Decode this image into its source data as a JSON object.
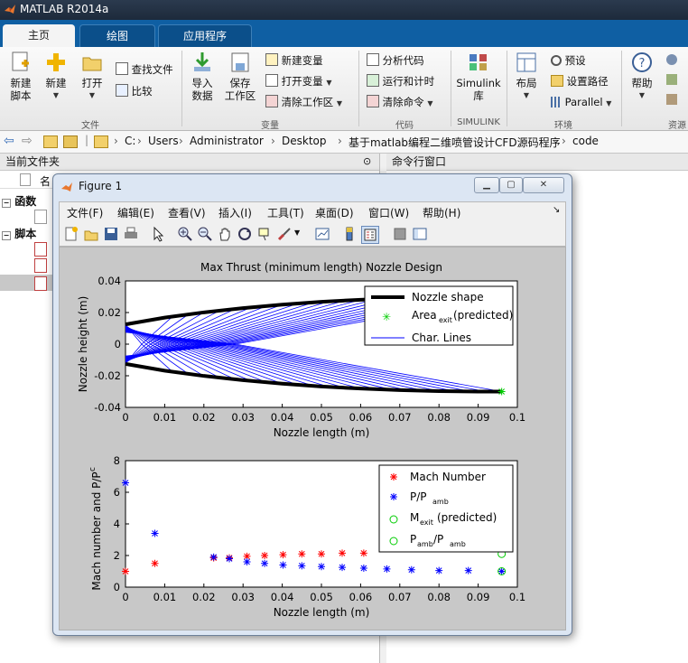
{
  "app": {
    "title": "MATLAB R2014a"
  },
  "tabs": [
    {
      "label": "主页",
      "active": true
    },
    {
      "label": "绘图",
      "active": false
    },
    {
      "label": "应用程序",
      "active": false
    }
  ],
  "ribbon": {
    "new_script": "新建\n脚本",
    "new": "新建",
    "open": "打开",
    "find_files": "查找文件",
    "compare": "比较",
    "file_group": "文件",
    "import_data": "导入\n数据",
    "save_workspace": "保存\n工作区",
    "new_variable": "新建变量",
    "open_variable": "打开变量",
    "clear_workspace": "清除工作区",
    "variable_group": "变量",
    "analyze_code": "分析代码",
    "run_and_time": "运行和计时",
    "clear_commands": "清除命令",
    "code_group": "代码",
    "simulink_lib": "Simulink\n库",
    "simulink_group": "SIMULINK",
    "layout": "布局",
    "preferences": "预设",
    "set_path": "设置路径",
    "parallel": "Parallel",
    "environment_group": "环境",
    "help": "帮助",
    "resources_group": "资源"
  },
  "address": {
    "crumbs": [
      "C:",
      "Users",
      "Administrator",
      "Desktop",
      "基于matlab编程二维喷管设计CFD源码程序",
      "code"
    ]
  },
  "panels": {
    "current_folder": "当前文件夹",
    "command_window": "命令行窗口",
    "name_col": "名",
    "functions": "函数",
    "scripts": "脚本"
  },
  "figure": {
    "title": "Figure 1",
    "menu": [
      "文件(F)",
      "编辑(E)",
      "查看(V)",
      "插入(I)",
      "工具(T)",
      "桌面(D)",
      "窗口(W)",
      "帮助(H)"
    ]
  },
  "chart_data": [
    {
      "type": "line",
      "title": "Max Thrust (minimum length) Nozzle Design",
      "xlabel": "Nozzle length (m)",
      "ylabel": "Nozzle height (m)",
      "xlim": [
        0,
        0.1
      ],
      "ylim": [
        -0.04,
        0.04
      ],
      "xticks": [
        "0",
        "0.01",
        "0.02",
        "0.03",
        "0.04",
        "0.05",
        "0.06",
        "0.07",
        "0.08",
        "0.09",
        "0.1"
      ],
      "yticks": [
        "0.04",
        "0.02",
        "0",
        "-0.02",
        "-0.04"
      ],
      "legend": {
        "placement": "top-right",
        "entries": [
          "Nozzle shape",
          "Area",
          "exit",
          "(predicted)",
          "Char. Lines"
        ]
      },
      "series": [
        {
          "name": "Nozzle shape",
          "color": "#000000",
          "x": [
            0,
            0.01,
            0.02,
            0.03,
            0.04,
            0.05,
            0.06,
            0.07,
            0.08,
            0.09,
            0.096
          ],
          "y": [
            0.0125,
            0.0168,
            0.0201,
            0.0228,
            0.025,
            0.0268,
            0.0281,
            0.0291,
            0.0297,
            0.03,
            0.03
          ]
        },
        {
          "name": "Area exit (predicted)",
          "color": "#00cc00",
          "x": [
            0.096
          ],
          "y": [
            0.03
          ]
        },
        {
          "name": "Char. Lines",
          "color": "#0000ff"
        }
      ],
      "nozzle_exit_x": 0.096,
      "throat_half_height": 0.0125,
      "exit_half_height": 0.03,
      "char_line_count": 22
    },
    {
      "type": "scatter",
      "title": "",
      "xlabel": "Nozzle length (m)",
      "ylabel": "Mach number and P/P",
      "ylabel_sub": "c",
      "xlim": [
        0,
        0.1
      ],
      "ylim": [
        0,
        8
      ],
      "xticks": [
        "0",
        "0.01",
        "0.02",
        "0.03",
        "0.04",
        "0.05",
        "0.06",
        "0.07",
        "0.08",
        "0.09",
        "0.1"
      ],
      "yticks": [
        "8",
        "6",
        "4",
        "2",
        "0"
      ],
      "legend": {
        "placement": "top-right",
        "entries": [
          "Mach Number",
          "P/P",
          "amb",
          "M",
          "exit",
          "(predicted)",
          "P",
          "amb",
          "/P",
          "amb"
        ]
      },
      "series": [
        {
          "name": "Mach Number",
          "color": "#ff0000",
          "marker": "*",
          "x": [
            0,
            0.0075,
            0.0225,
            0.0265,
            0.031,
            0.0355,
            0.0402,
            0.045,
            0.05,
            0.0553,
            0.0608
          ],
          "y": [
            1.0,
            1.5,
            1.85,
            1.85,
            1.95,
            2.0,
            2.05,
            2.1,
            2.1,
            2.15,
            2.15
          ]
        },
        {
          "name": "P/P amb",
          "color": "#0000ff",
          "marker": "*",
          "x": [
            0,
            0.0075,
            0.0225,
            0.0265,
            0.031,
            0.0355,
            0.0402,
            0.045,
            0.05,
            0.0553,
            0.0608,
            0.0667,
            0.073,
            0.08,
            0.0875,
            0.096
          ],
          "y": [
            6.6,
            3.4,
            1.9,
            1.8,
            1.6,
            1.5,
            1.4,
            1.35,
            1.3,
            1.25,
            1.2,
            1.15,
            1.1,
            1.05,
            1.05,
            1.0
          ]
        },
        {
          "name": "M exit (predicted)",
          "color": "#00cc00",
          "marker": "o",
          "x": [
            0.096
          ],
          "y": [
            2.1
          ]
        },
        {
          "name": "P amb / P amb",
          "color": "#00cc00",
          "marker": "o",
          "x": [
            0.096
          ],
          "y": [
            1.0
          ]
        }
      ]
    }
  ]
}
